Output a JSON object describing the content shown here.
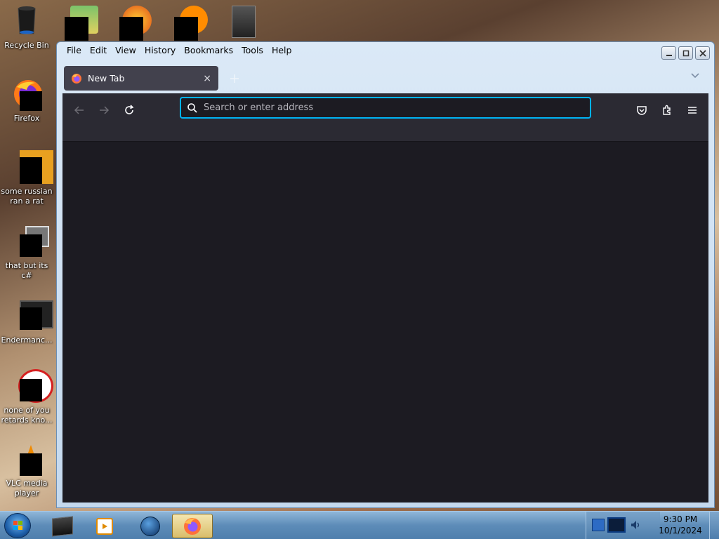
{
  "desktop": {
    "icons": [
      {
        "label": "Recycle Bin",
        "icon": "recycle-bin-icon"
      },
      {
        "label": "Firefox",
        "icon": "firefox-icon"
      },
      {
        "label": "some russian ran a rat",
        "icon": "app-icon"
      },
      {
        "label": "that but its c#",
        "icon": "app-icon"
      },
      {
        "label": "Endermanc...",
        "icon": "app-icon"
      },
      {
        "label": "none of you retards kno...",
        "icon": "app-icon"
      },
      {
        "label": "VLC media player",
        "icon": "vlc-icon"
      }
    ]
  },
  "browser": {
    "menu": [
      "File",
      "Edit",
      "View",
      "History",
      "Bookmarks",
      "Tools",
      "Help"
    ],
    "tab": {
      "title": "New Tab",
      "close": "×"
    },
    "address_placeholder": "Search or enter address",
    "address_value": ""
  },
  "taskbar": {
    "clock_time": "9:30 PM",
    "clock_date": "10/1/2024"
  },
  "colors": {
    "url_focus": "#00b3f4",
    "toolbar": "#2b2a33",
    "content": "#1c1b22"
  }
}
